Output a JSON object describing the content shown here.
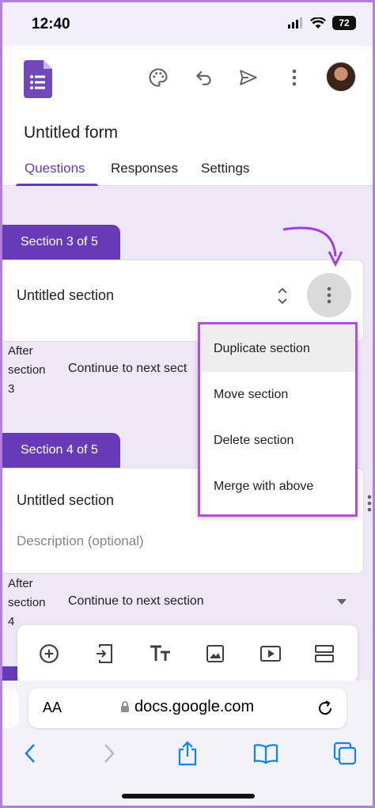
{
  "status": {
    "time": "12:40",
    "battery": "72"
  },
  "form": {
    "title": "Untitled form"
  },
  "tabs": [
    "Questions",
    "Responses",
    "Settings"
  ],
  "sections": [
    {
      "pill": "Section 3 of 5",
      "title": "Untitled section",
      "after_line1": "After",
      "after_line2": "section",
      "after_num": "3",
      "continue": "Continue to next sect"
    },
    {
      "pill": "Section 4 of 5",
      "title": "Untitled section",
      "description_placeholder": "Description (optional)",
      "after_line1": "After",
      "after_line2": "section",
      "after_num": "4",
      "continue": "Continue to next section"
    }
  ],
  "menu": {
    "items": [
      "Duplicate section",
      "Move section",
      "Delete section",
      "Merge with above"
    ]
  },
  "toolbar": {
    "icons": [
      "add-question-icon",
      "import-questions-icon",
      "add-title-icon",
      "add-image-icon",
      "add-video-icon",
      "add-section-icon"
    ]
  },
  "browser": {
    "aa": "AA",
    "url": "docs.google.com"
  },
  "colors": {
    "accent": "#673ab7",
    "highlight": "#b04fe0"
  }
}
